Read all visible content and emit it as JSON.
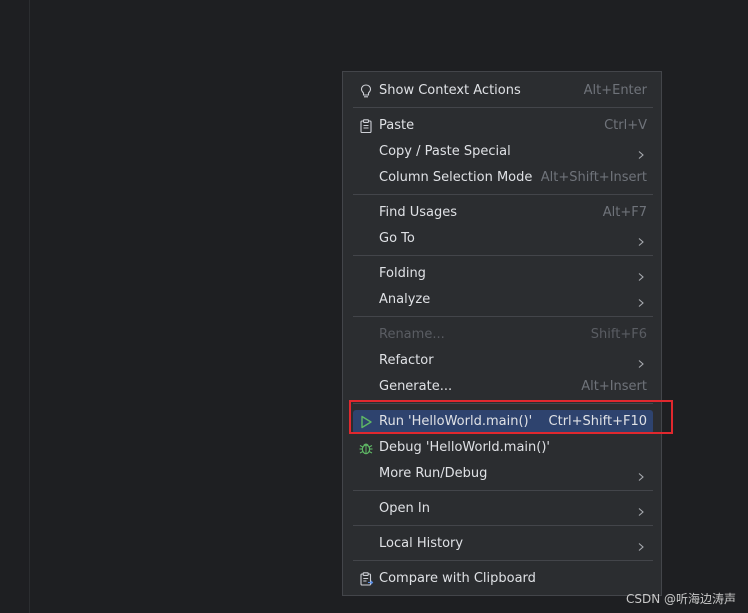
{
  "menu": {
    "items": [
      {
        "label": "Show Context Actions",
        "shortcut": "Alt+Enter",
        "icon": "lightbulb-icon"
      },
      {
        "label": "Paste",
        "shortcut": "Ctrl+V",
        "icon": "clipboard-icon"
      },
      {
        "label": "Copy / Paste Special",
        "submenu": true
      },
      {
        "label": "Column Selection Mode",
        "shortcut": "Alt+Shift+Insert"
      },
      {
        "label": "Find Usages",
        "shortcut": "Alt+F7"
      },
      {
        "label": "Go To",
        "submenu": true
      },
      {
        "label": "Folding",
        "submenu": true
      },
      {
        "label": "Analyze",
        "submenu": true
      },
      {
        "label": "Rename...",
        "shortcut": "Shift+F6",
        "disabled": true
      },
      {
        "label": "Refactor",
        "submenu": true
      },
      {
        "label": "Generate...",
        "shortcut": "Alt+Insert"
      },
      {
        "label": "Run 'HelloWorld.main()'",
        "shortcut": "Ctrl+Shift+F10",
        "icon": "run-triangle-icon",
        "selected": true
      },
      {
        "label": "Debug 'HelloWorld.main()'",
        "icon": "debug-bug-icon"
      },
      {
        "label": "More Run/Debug",
        "submenu": true
      },
      {
        "label": "Open In",
        "submenu": true
      },
      {
        "label": "Local History",
        "submenu": true
      },
      {
        "label": "Compare with Clipboard",
        "icon": "compare-clipboard-icon"
      }
    ]
  },
  "watermark": "CSDN @听海边涛声",
  "colors": {
    "background": "#1e1f22",
    "menu_bg": "#2b2d30",
    "selection": "#2e436e",
    "highlight_box": "#e0282e",
    "run_icon": "#5fb865",
    "debug_icon": "#5fb865"
  }
}
